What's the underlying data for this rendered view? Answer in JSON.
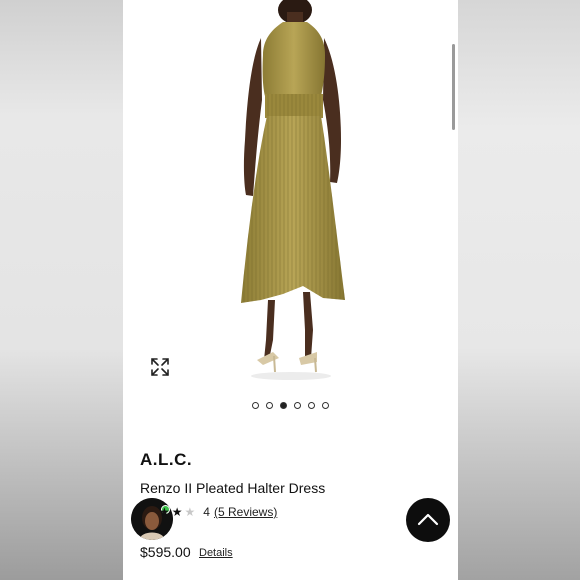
{
  "product": {
    "brand": "A.L.C.",
    "name": "Renzo II Pleated Halter Dress",
    "rating_value": "4",
    "reviews_label": "(5 Reviews)",
    "rating_stars": 2,
    "price": "$595.00",
    "details_label": "Details"
  },
  "carousel": {
    "total": 6,
    "active_index": 2
  },
  "colors": {
    "dress": "#a39144",
    "accent_online": "#3cc24a",
    "button": "#0d0d0d"
  },
  "icons": [
    "expand-icon",
    "chevron-up-icon",
    "star-icon"
  ]
}
